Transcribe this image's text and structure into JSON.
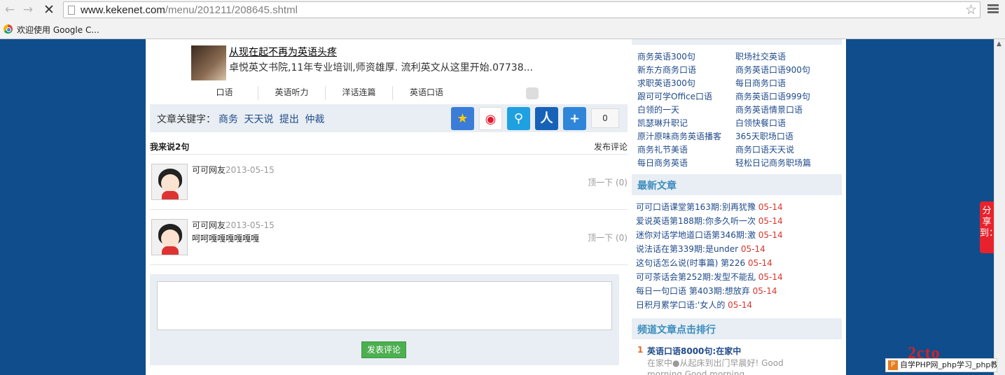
{
  "browser": {
    "url_host": "www.kekenet.com",
    "url_path": "/menu/201211/208645.shtml",
    "bookmark": "欢迎使用 Google C..."
  },
  "ad": {
    "title": "从现在起不再为英语头疼",
    "desc": "卓悦英文书院,11年专业培训,师资雄厚. 流利英文从这里开始.07738..."
  },
  "tags": [
    "口语",
    "英语听力",
    "洋话连篇",
    "英语口语"
  ],
  "keywords": {
    "label": "文章关键字：",
    "words": [
      "商务",
      "天天说",
      "提出",
      "仲裁"
    ]
  },
  "share_count": "0",
  "comments_header": {
    "title": "我来说2句",
    "post_link": "发布评论"
  },
  "comments": [
    {
      "user": "可可网友",
      "date": "2013-05-15",
      "text": "",
      "vote": "顶一下 (0)"
    },
    {
      "user": "可可网友",
      "date": "2013-05-15",
      "text": "呵呵嘎嘎嘎嘎嘎嘎",
      "vote": "顶一下 (0)"
    }
  ],
  "reply": {
    "button": "发表评论"
  },
  "sidebar": {
    "links": [
      [
        "商务英语300句",
        "职场社交英语"
      ],
      [
        "新东方商务口语",
        "商务英语口语900句"
      ],
      [
        "求职英语300句",
        "每日商务口语"
      ],
      [
        "跟可可学Office口语",
        "商务英语口语999句"
      ],
      [
        "白领的一天",
        "商务英语情景口语"
      ],
      [
        "凯瑟琳升职记",
        "白领快餐口语"
      ],
      [
        "原汁原味商务英语播客",
        "365天职场口语"
      ],
      [
        "商务礼节美语",
        "商务口语天天说"
      ],
      [
        "每日商务英语",
        "轻松日记商务职场篇"
      ]
    ],
    "latest_title": "最新文章",
    "latest": [
      {
        "title": "可可口语课堂第163期:别再犹豫",
        "date": "05-14"
      },
      {
        "title": "爱说英语第188期:你多久听一次",
        "date": "05-14"
      },
      {
        "title": "迷你对话学地道口语第346期:激",
        "date": "05-14"
      },
      {
        "title": "说法话在第339期:是under",
        "date": "05-14"
      },
      {
        "title": "这句话怎么说(时事篇) 第226",
        "date": "05-14"
      },
      {
        "title": "可可茶话会第252期:发型不能乱",
        "date": "05-14"
      },
      {
        "title": "每日一句口语 第403期:想放弃",
        "date": "05-14"
      },
      {
        "title": "日积月累学口语:'女人的",
        "date": "05-14"
      }
    ],
    "rank_title": "频道文章点击排行",
    "rank": [
      {
        "num": "1",
        "title": "英语口语8000句:在家中",
        "desc": "在家中●从起床到出门早晨好! Good morning.Good morning"
      }
    ]
  },
  "float_share": "分享到：",
  "watermark": {
    "logo": "2cto",
    "bar": "自学PHP网_php学习_php教程"
  }
}
